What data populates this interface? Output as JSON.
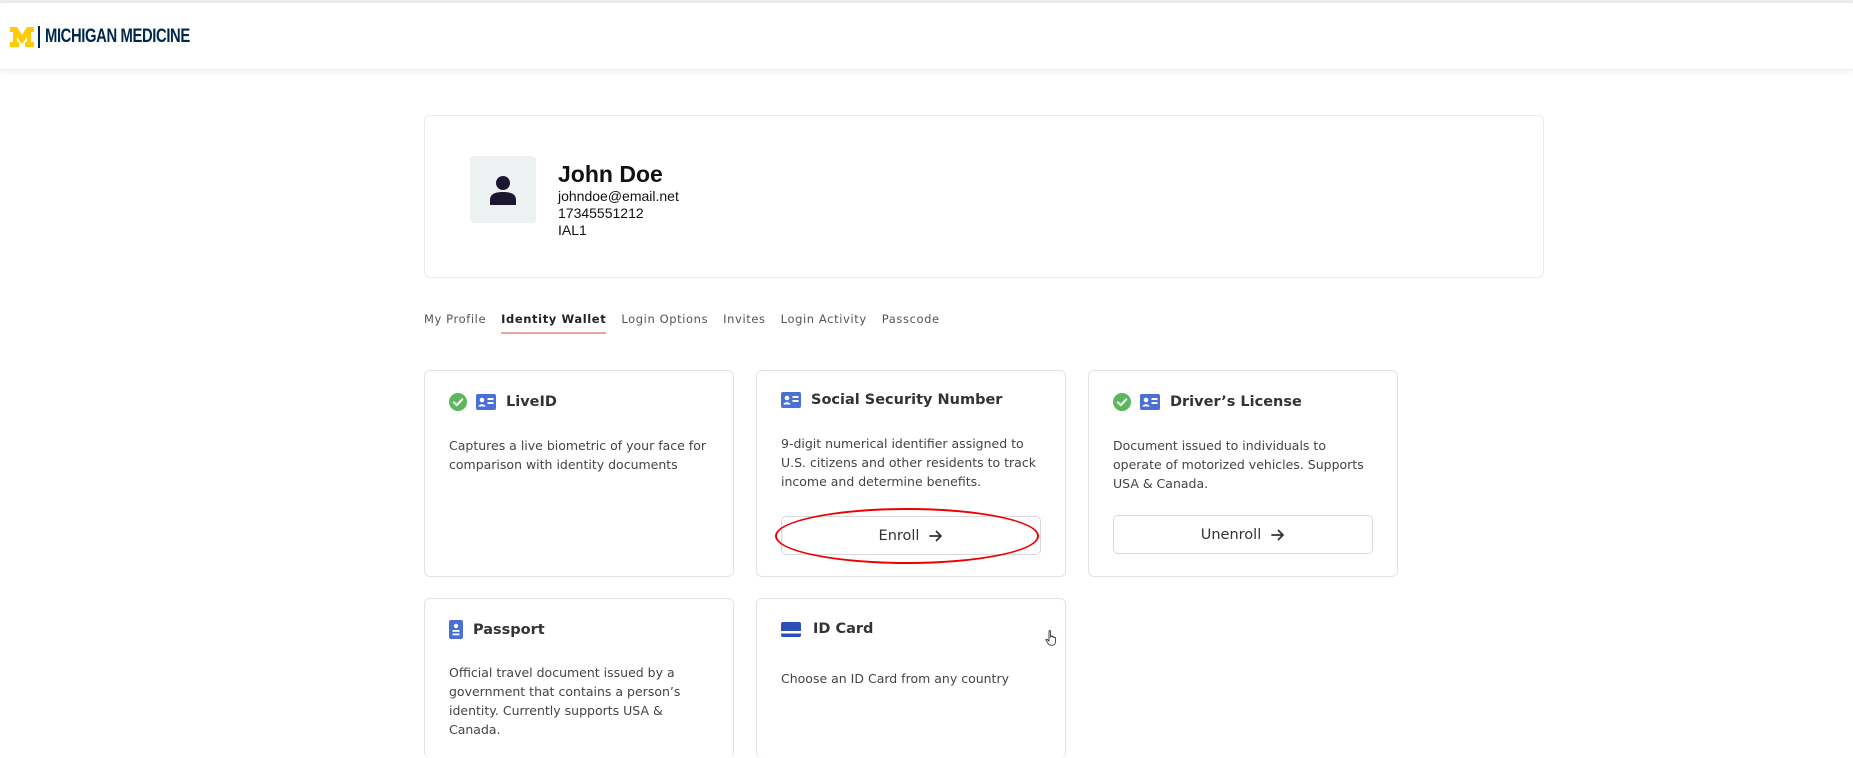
{
  "header": {
    "logo_text": "MICHIGAN MEDICINE",
    "logo_icon": "block-m-logo",
    "brand_blue": "#00274c",
    "brand_maize": "#ffcb05"
  },
  "profile": {
    "avatar_icon": "user-avatar-icon",
    "name": "John Doe",
    "email": "johndoe@email.net",
    "phone": "17345551212",
    "level": "IAL1"
  },
  "tabs": [
    {
      "label": "My Profile",
      "active": false
    },
    {
      "label": "Identity Wallet",
      "active": true
    },
    {
      "label": "Login Options",
      "active": false
    },
    {
      "label": "Invites",
      "active": false
    },
    {
      "label": "Login Activity",
      "active": false
    },
    {
      "label": "Passcode",
      "active": false
    }
  ],
  "cards": {
    "liveid": {
      "title": "LiveID",
      "verified": true,
      "description": "Captures a live biometric of your face for comparison with identity documents"
    },
    "ssn": {
      "title": "Social Security Number",
      "verified": false,
      "description": "9-digit numerical identifier assigned to U.S. citizens and other residents to track income and determine benefits.",
      "button_label": "Enroll"
    },
    "drivers_license": {
      "title": "Driver’s License",
      "verified": true,
      "description": "Document issued to individuals to operate of motorized vehicles. Supports USA & Canada.",
      "button_label": "Unenroll"
    },
    "passport": {
      "title": "Passport",
      "verified": false,
      "description": "Official travel document issued by a government that contains a person’s identity. Currently supports USA & Canada."
    },
    "id_card": {
      "title": "ID Card",
      "verified": false,
      "description": "Choose an ID Card from any country"
    }
  },
  "colors": {
    "check_green": "#5cb85c",
    "doc_icon_blue": "#4a6fd6",
    "active_tab_underline": "#e8a4a4",
    "annotation_red": "#e00000"
  }
}
